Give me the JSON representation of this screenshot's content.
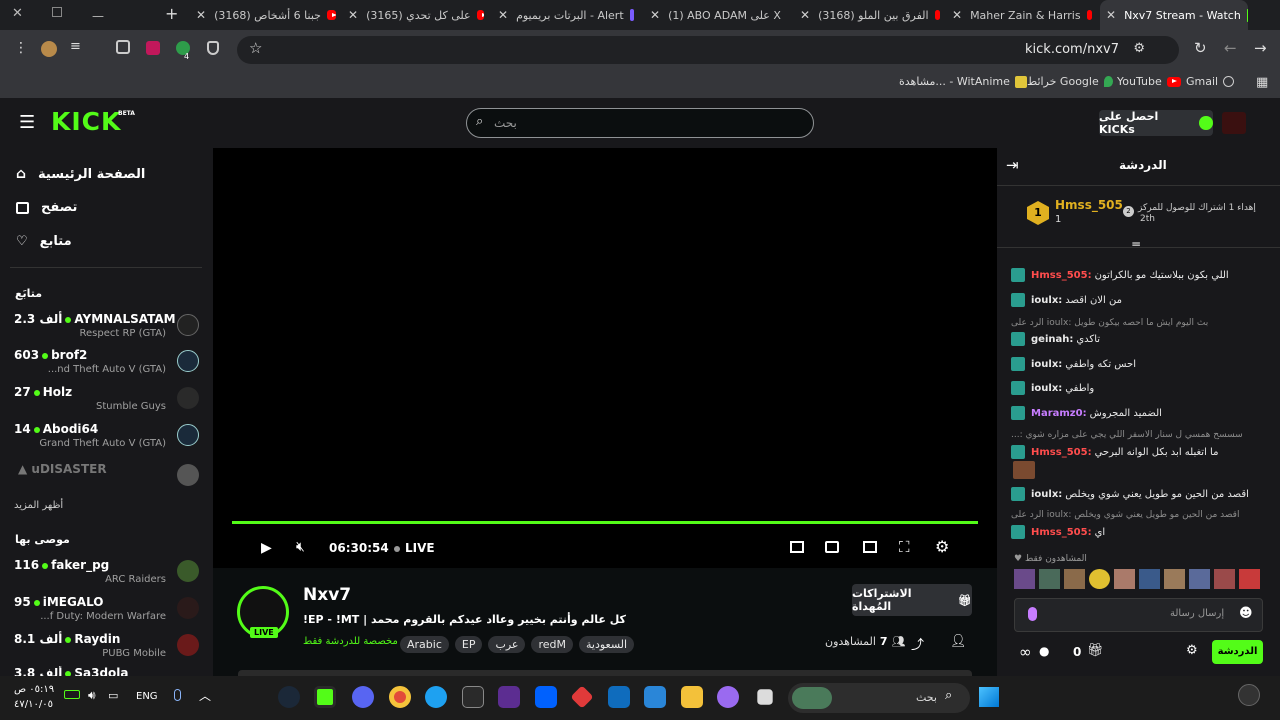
{
  "tabs": [
    {
      "label": "(3168) جبنا 6 أشخاص"
    },
    {
      "label": "(3165) على كل تحدي"
    },
    {
      "label": "البرتات بريميوم - Alert"
    },
    {
      "label": "(1) ABO ADAM على X"
    },
    {
      "label": "(3168) الفرق بين الملو"
    },
    {
      "label": "Maher Zain & Harris"
    },
    {
      "label": "Nxv7 Stream - Watch"
    }
  ],
  "address": {
    "url": "kick.com/nxv7"
  },
  "bookmarks": [
    {
      "label": "Gmail"
    },
    {
      "label": "YouTube"
    },
    {
      "label": "خرائط Google"
    },
    {
      "label": "مشاهدة... - WitAnime"
    }
  ],
  "topnav": {
    "logo": "KICK",
    "logo_beta": "BETA",
    "search_placeholder": "بحث",
    "get_kicks": "احصل على KICKs"
  },
  "sidebar": {
    "nav": [
      {
        "label": "الصفحة الرئيسية"
      },
      {
        "label": "تصفح"
      },
      {
        "label": "متابع"
      }
    ],
    "following_title": "متابَع",
    "following": [
      {
        "viewers": "2.3 ألف",
        "name": "AYMNALSATAM",
        "game": "Respect RP (GTA)"
      },
      {
        "viewers": "603",
        "name": "brof2",
        "game": "...nd Theft Auto V (GTA)"
      },
      {
        "viewers": "27",
        "name": "Holz",
        "game": "Stumble Guys"
      },
      {
        "viewers": "14",
        "name": "Abodi64",
        "game": "Grand Theft Auto V (GTA)"
      },
      {
        "viewers": "",
        "name": "uDISASTER",
        "game": ""
      }
    ],
    "show_more": "أظهر المزيد",
    "recommended_title": "موصى بها",
    "recommended": [
      {
        "viewers": "116",
        "name": "faker_pg",
        "game": "ARC Raiders"
      },
      {
        "viewers": "95",
        "name": "iMEGALO",
        "game": "...f Duty: Modern Warfare"
      },
      {
        "viewers": "8.1 ألف",
        "name": "Raydin",
        "game": "PUBG Mobile"
      },
      {
        "viewers": "3.8 ألف",
        "name": "Sa3dola",
        "game": ""
      }
    ]
  },
  "player": {
    "time": "06:30:54",
    "live": "LIVE",
    "progress": 1.0
  },
  "stream": {
    "channel": "Nxv7",
    "live_badge": "LIVE",
    "title": "!EP - !MT | كل عالم وأنتم بخيير وعااد عيدكم بالقروم محمد",
    "chat_note": "مخصصة للدردشة فقط",
    "tags": [
      "Arabic",
      "EP",
      "عرب",
      "redM",
      "السعودية"
    ],
    "subscribe_button": "الاشتراكات المُهداة",
    "viewers_label": "المشاهدون",
    "viewers_count": "7"
  },
  "chat": {
    "title": "الدردشة",
    "leader_name": "Hmss_505",
    "leader_count": "1",
    "leader_rank": "2th",
    "leader_prompt": "إهداء 1 اشتراك للوصول للمركز",
    "messages": [
      {
        "user": "Hmss_505:",
        "text": "اللي بكون ببلاستيك مو بالكراتون",
        "color": "#ff4d4d"
      },
      {
        "user": "ioulx:",
        "text": "من الان اقصد",
        "color": "#ffffff"
      },
      {
        "reply": "الرد على ioulx: بث اليوم ايش ما احصه بيكون طويل"
      },
      {
        "user": "geinah:",
        "text": "تاكدي",
        "color": "#ffffff"
      },
      {
        "user": "ioulx:",
        "text": "احس تكه واطفي",
        "color": "#ffffff"
      },
      {
        "user": "ioulx:",
        "text": "واطفي",
        "color": "#ffffff"
      },
      {
        "user": "Maramz0:",
        "text": "الضميد المجروش",
        "color": "#c77dff"
      },
      {
        "reply": "...: سسسح همسي ل سنار الاسفر اللي يجي على مزاره شوي"
      },
      {
        "user": "Hmss_505:",
        "text": "ما اتغبله ابد بكل الوانه البرحي",
        "color": "#ff4d4d"
      },
      {
        "user": "ioulx:",
        "text": "اقصد من الحين مو طويل يعني شوي ويخلص",
        "color": "#ffffff"
      },
      {
        "reply": "الرد على ioulx: اقصد من الحين مو طويل يعني شوي ويخلص"
      },
      {
        "user": "Hmss_505:",
        "text": "اي",
        "color": "#ff4d4d"
      }
    ],
    "viewers_only": "المشاهدون فقط",
    "input_placeholder": "إرسال رسالة",
    "points": "0",
    "send_button": "الدردشة"
  },
  "taskbar": {
    "search_placeholder": "بحث",
    "lang": "ENG",
    "time": "٠٥:١٩ ص",
    "date": "٤٧/١٠/٠٥"
  }
}
